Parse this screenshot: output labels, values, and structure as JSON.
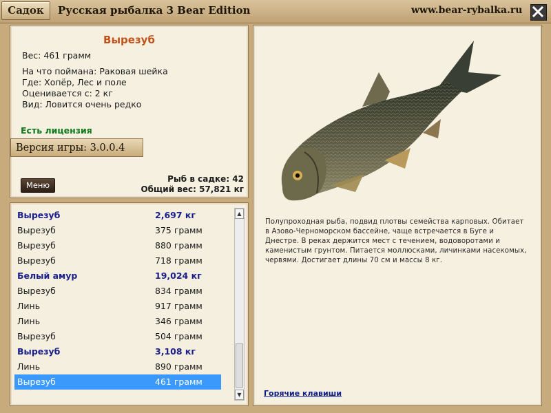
{
  "header": {
    "sadok_label": "Садок",
    "title": "Русская рыбалка 3 Bear Edition",
    "site_url": "www.bear-rybalka.ru",
    "close_icon": "close-icon"
  },
  "fish": {
    "name": "Вырезуб",
    "weight_line": "Вес: 461 грамм",
    "bait_line": "На что поймана: Раковая шейка",
    "where_line": "Где: Хопёр, Лес и поле",
    "valued_line": "Оценивается с: 2 кг",
    "kind_line": "Вид: Ловится очень редко",
    "license": "Есть лицензия",
    "description": "Полупроходная рыба, подвид плотвы семейства карповых. Обитает в Азово-Черноморском бассейне, чаще встречается в Буге и Днестре. В реках держится мест с течением, водоворотами и каменистым грунтом. Питается моллюсками, личинками насекомых, червями. Достигает длины 70 см и массы 8 кг."
  },
  "version_label": "Версия игры: 3.0.0.4",
  "menu_label": "Меню",
  "stats": {
    "fish_count": "Рыб в садке: 42",
    "total_weight": "Общий вес: 57,821 кг"
  },
  "catch_list": [
    {
      "name": "Вырезуб",
      "weight": "2,697 кг",
      "bold": true
    },
    {
      "name": "Вырезуб",
      "weight": "375 грамм"
    },
    {
      "name": "Вырезуб",
      "weight": "880 грамм"
    },
    {
      "name": "Вырезуб",
      "weight": "718 грамм"
    },
    {
      "name": "Белый амур",
      "weight": "19,024 кг",
      "bold": true
    },
    {
      "name": "Вырезуб",
      "weight": "834 грамм"
    },
    {
      "name": "Линь",
      "weight": "917 грамм"
    },
    {
      "name": "Линь",
      "weight": "346 грамм"
    },
    {
      "name": "Вырезуб",
      "weight": "504 грамм"
    },
    {
      "name": "Вырезуб",
      "weight": "3,108 кг",
      "bold": true
    },
    {
      "name": "Линь",
      "weight": "890 грамм"
    },
    {
      "name": "Вырезуб",
      "weight": "461 грамм",
      "selected": true
    }
  ],
  "hotkeys_link": "Горячие клавиши",
  "colors": {
    "fish_name": "#c0531b",
    "license": "#0f7a1c",
    "trophy_rows": "#1a1f8c",
    "selection": "#3b99fc",
    "link": "#0b1c8f"
  }
}
